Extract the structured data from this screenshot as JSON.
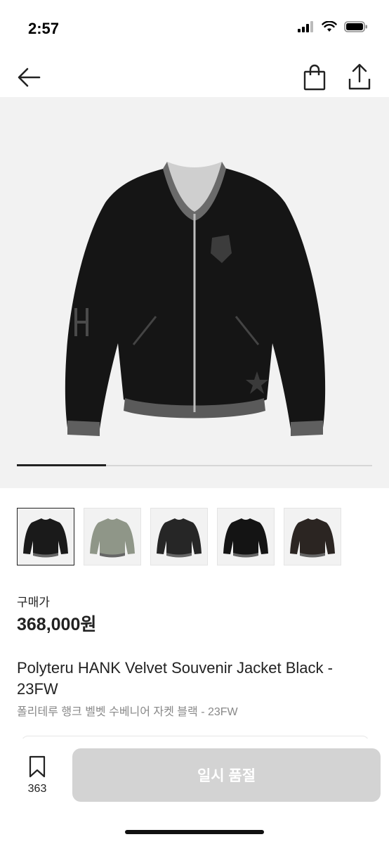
{
  "status": {
    "time": "2:57"
  },
  "nav": {
    "back_icon": "arrow-left-icon",
    "cart_icon": "shopping-bag-icon",
    "share_icon": "share-icon"
  },
  "gallery": {
    "current_index": 1,
    "total_images": 4,
    "progress_fraction": 0.25
  },
  "thumbnails": [
    {
      "alt": "black velvet jacket front",
      "color": "#1a1a1a",
      "active": true
    },
    {
      "alt": "sage green bomber jacket",
      "color": "#8f9688",
      "active": false
    },
    {
      "alt": "black jacket front",
      "color": "#262626",
      "active": false
    },
    {
      "alt": "black jacket front dark",
      "color": "#141414",
      "active": false
    },
    {
      "alt": "brown black jacket",
      "color": "#2b2522",
      "active": false
    }
  ],
  "product": {
    "price_label": "구매가",
    "price": "368,000원",
    "title_en": "Polyteru HANK Velvet Souvenir Jacket Black - 23FW",
    "title_ko": "폴리테루 행크 벨벳 수베니어 자켓 블랙 - 23FW"
  },
  "bottom": {
    "bookmark_count": "363",
    "soldout_label": "일시 품절"
  },
  "colors": {
    "button_disabled": "#d3d3d3",
    "jacket": "#151515",
    "background": "#f2f2f2"
  }
}
